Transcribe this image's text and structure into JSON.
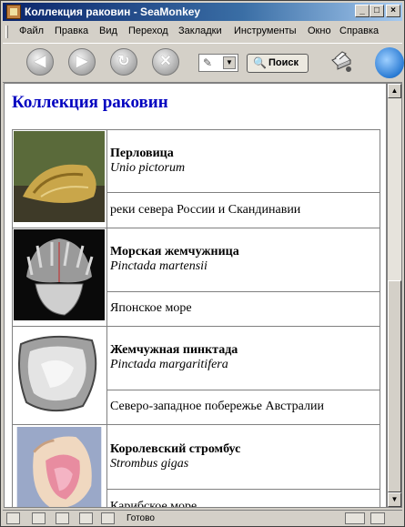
{
  "window": {
    "title": "Коллекция раковин - SeaMonkey",
    "controls": [
      "_",
      "□",
      "×"
    ]
  },
  "menubar": {
    "items": [
      "Файл",
      "Правка",
      "Вид",
      "Переход",
      "Закладки",
      "Инструменты",
      "Окно",
      "Справка"
    ]
  },
  "toolbar": {
    "search_label": "Поиск"
  },
  "page": {
    "title": "Коллекция раковин",
    "shells": [
      {
        "name": "Перловица",
        "latin": "Unio pictorum",
        "habitat": "реки севера России и Скандинавии"
      },
      {
        "name": "Морская жемчужница",
        "latin": "Pinctada martensii",
        "habitat": "Японское море"
      },
      {
        "name": "Жемчужная пинктада",
        "latin": "Pinctada margaritifera",
        "habitat": "Северо-западное побережье Австралии"
      },
      {
        "name": "Королевский стромбус",
        "latin": "Strombus gigas",
        "habitat": "Карибское море"
      }
    ]
  },
  "statusbar": {
    "text": "Готово"
  },
  "colors": {
    "title_bar_start": "#0a246a",
    "page_title": "#0000c0",
    "chrome": "#d4d0c8"
  }
}
